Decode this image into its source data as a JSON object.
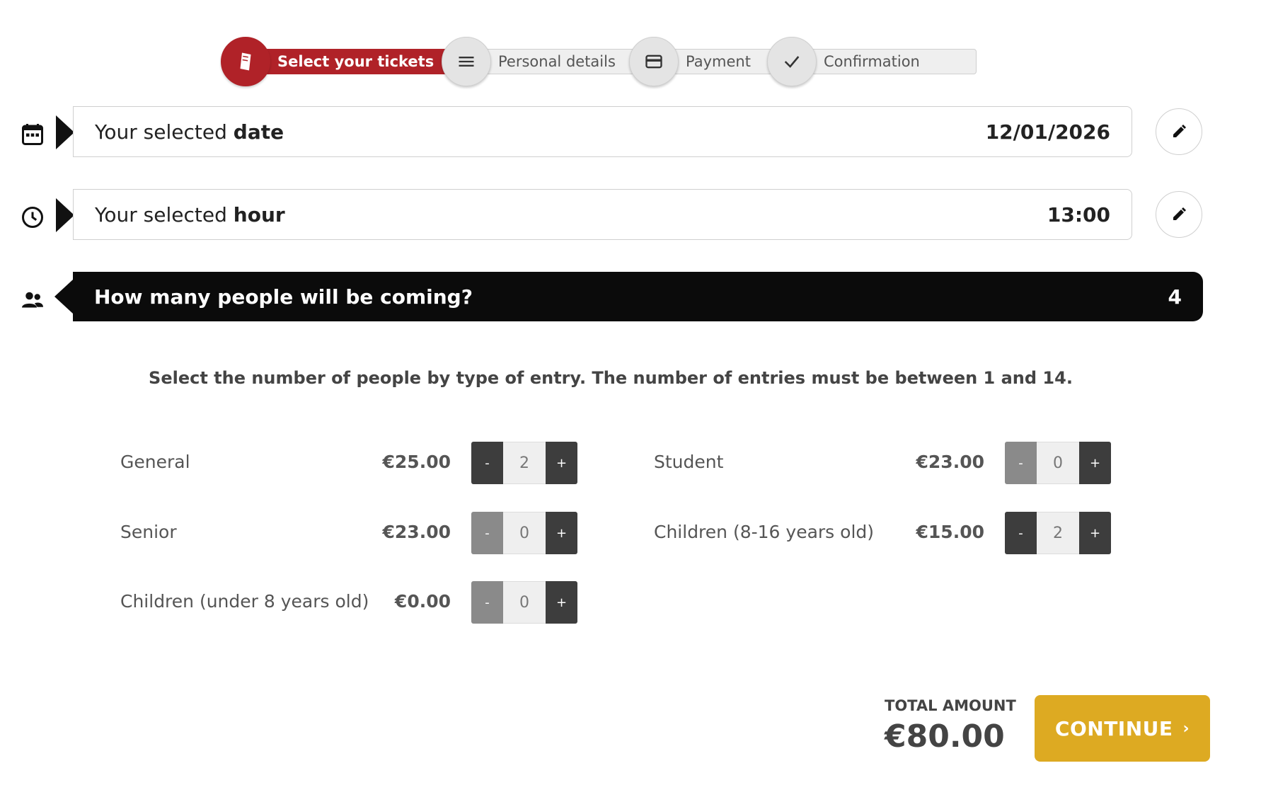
{
  "steps": [
    {
      "label": "Select your tickets",
      "icon": "ticket-icon",
      "active": true
    },
    {
      "label": "Personal details",
      "icon": "menu-lines-icon",
      "active": false
    },
    {
      "label": "Payment",
      "icon": "credit-card-icon",
      "active": false
    },
    {
      "label": "Confirmation",
      "icon": "checkmark-icon",
      "active": false
    }
  ],
  "date_row": {
    "prefix": "Your selected ",
    "bold": "date",
    "value": "12/01/2026"
  },
  "hour_row": {
    "prefix": "Your selected ",
    "bold": "hour",
    "value": "13:00"
  },
  "people_row": {
    "title": "How many people will be coming?",
    "count": "4"
  },
  "instructions": "Select the number of people by type of entry. The number of entries must be between 1 and 14.",
  "tickets": [
    {
      "name": "General",
      "price": "€25.00",
      "qty": "2",
      "minus": "-",
      "plus": "+"
    },
    {
      "name": "Student",
      "price": "€23.00",
      "qty": "0",
      "minus": "-",
      "plus": "+"
    },
    {
      "name": "Senior",
      "price": "€23.00",
      "qty": "0",
      "minus": "-",
      "plus": "+"
    },
    {
      "name": "Children (8-16 years old)",
      "price": "€15.00",
      "qty": "2",
      "minus": "-",
      "plus": "+"
    },
    {
      "name": "Children (under 8 years old)",
      "price": "€0.00",
      "qty": "0",
      "minus": "-",
      "plus": "+"
    }
  ],
  "total": {
    "label": "TOTAL AMOUNT",
    "value": "€80.00"
  },
  "continue_label": "CONTINUE",
  "colors": {
    "accent": "#b02228",
    "continue": "#ddaa22",
    "dark": "#0b0b0b"
  }
}
